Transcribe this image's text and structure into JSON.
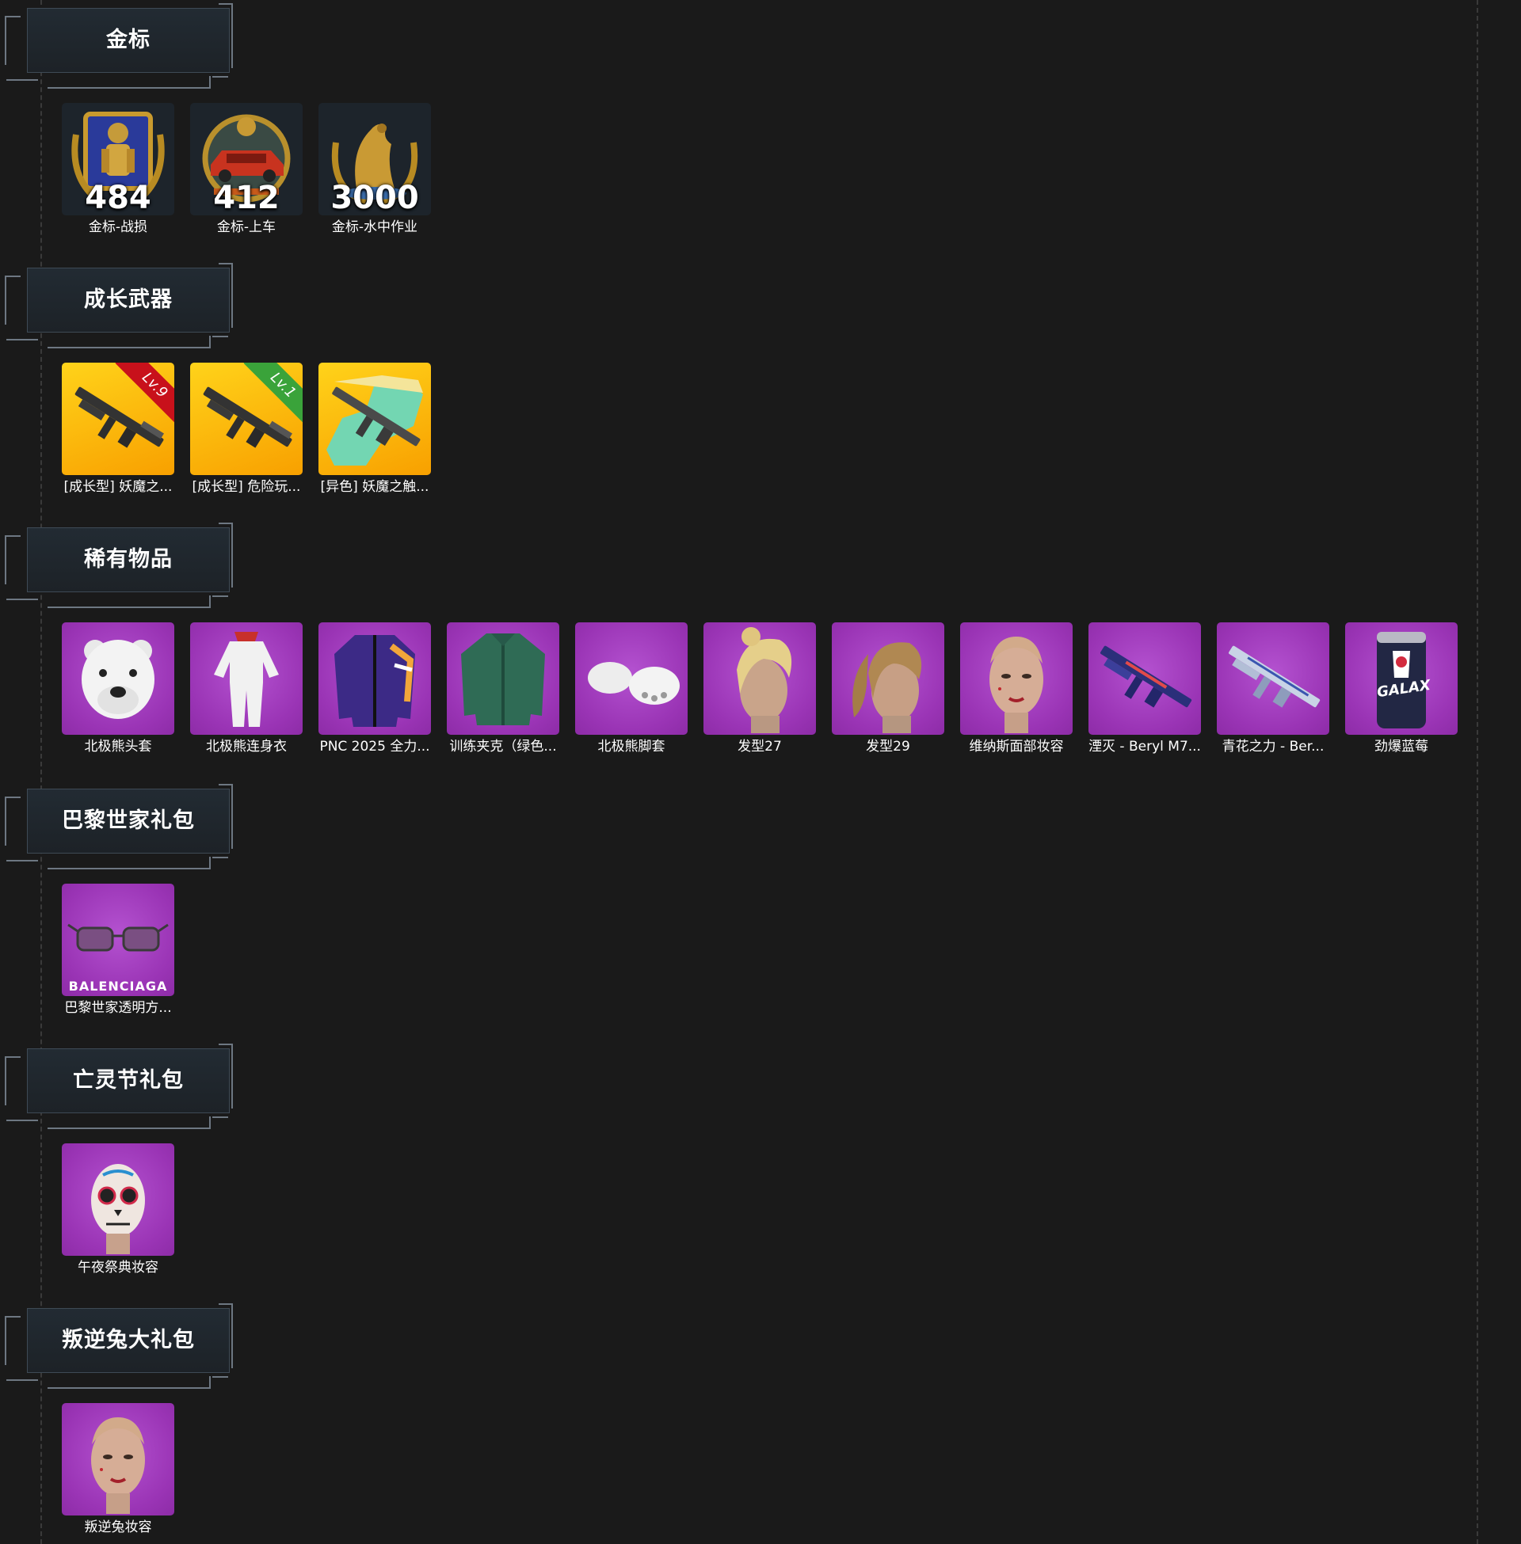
{
  "sections": [
    {
      "title": "金标",
      "items": [
        {
          "label": "金标-战损",
          "value": "484",
          "bg": "dark",
          "icon": "gold-badge-soldier-icon"
        },
        {
          "label": "金标-上车",
          "value": "412",
          "bg": "dark",
          "icon": "gold-badge-car-icon"
        },
        {
          "label": "金标-水中作业",
          "value": "3000",
          "bg": "dark",
          "icon": "gold-badge-seal-icon"
        }
      ]
    },
    {
      "title": "成长武器",
      "items": [
        {
          "label": "[成长型] 妖魔之...",
          "level": "Lv.9",
          "level_color": "#c8111b",
          "bg": "gold",
          "icon": "rifle-icon"
        },
        {
          "label": "[成长型] 危险玩...",
          "level": "Lv.1",
          "level_color": "#3aa33a",
          "bg": "gold",
          "icon": "rifle-icon"
        },
        {
          "label": "[异色] 妖魔之触...",
          "bg": "gold",
          "icon": "rifle-map-icon"
        }
      ]
    },
    {
      "title": "稀有物品",
      "items": [
        {
          "label": "北极熊头套",
          "bg": "purple",
          "icon": "polar-bear-head-icon"
        },
        {
          "label": "北极熊连身衣",
          "bg": "purple",
          "icon": "bodysuit-icon"
        },
        {
          "label": "PNC 2025 全力...",
          "bg": "purple",
          "icon": "jacket-icon"
        },
        {
          "label": "训练夹克（绿色...",
          "bg": "purple",
          "icon": "green-jacket-icon"
        },
        {
          "label": "北极熊脚套",
          "bg": "purple",
          "icon": "paw-slippers-icon"
        },
        {
          "label": "发型27",
          "bg": "purple",
          "icon": "hair-bun-head-icon"
        },
        {
          "label": "发型29",
          "bg": "purple",
          "icon": "ponytail-head-icon"
        },
        {
          "label": "维纳斯面部妆容",
          "bg": "purple",
          "icon": "face-makeup-icon"
        },
        {
          "label": "湮灭 - Beryl M7...",
          "bg": "purple",
          "icon": "blue-rifle-icon"
        },
        {
          "label": "青花之力 - Ber...",
          "bg": "purple",
          "icon": "porcelain-rifle-icon"
        },
        {
          "label": "劲爆蓝莓",
          "bg": "purple",
          "icon": "soda-can-icon",
          "can_text": "GALAX"
        }
      ]
    },
    {
      "title": "巴黎世家礼包",
      "items": [
        {
          "label": "巴黎世家透明方...",
          "bg": "purple",
          "icon": "sunglasses-icon",
          "brand": "BALENCIAGA"
        }
      ]
    },
    {
      "title": "亡灵节礼包",
      "items": [
        {
          "label": "午夜祭典妆容",
          "bg": "purple",
          "icon": "skull-makeup-face-icon"
        }
      ]
    },
    {
      "title": "叛逆兔大礼包",
      "items": [
        {
          "label": "叛逆兔妆容",
          "bg": "purple",
          "icon": "face-makeup-icon"
        }
      ]
    }
  ]
}
